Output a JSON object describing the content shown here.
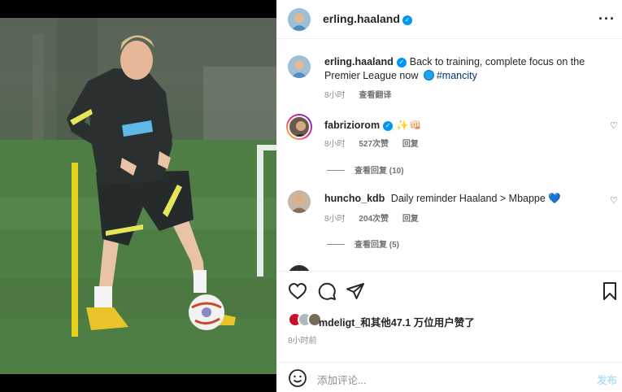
{
  "post": {
    "author": "erling.haaland",
    "more_icon": "more-horizontal-icon"
  },
  "caption": {
    "author": "erling.haaland",
    "text_before": "Back to training, complete focus on the Premier League now",
    "hashtag": "#mancity",
    "time": "8小时",
    "translate": "查看翻译"
  },
  "comments": [
    {
      "user": "fabriziorom",
      "text": "✨👊🏻",
      "time": "8小时",
      "likes": "527次赞",
      "reply": "回复",
      "view_replies": "查看回复 (10)"
    },
    {
      "user": "huncho_kdb",
      "text": "Daily reminder Haaland > Mbappe 💙",
      "time": "8小时",
      "likes": "204次赞",
      "reply": "回复",
      "view_replies": "查看回复 (5)"
    }
  ],
  "actions": {
    "likes_text": "mdeligt_和其他47.1 万位用户赞了",
    "time_ago": "8小时前"
  },
  "comment_input": {
    "placeholder": "添加评论...",
    "post_label": "发布"
  },
  "colors": {
    "verified": "#0095f6",
    "hashtag": "#00376b",
    "post_disabled": "#b2dffc"
  }
}
